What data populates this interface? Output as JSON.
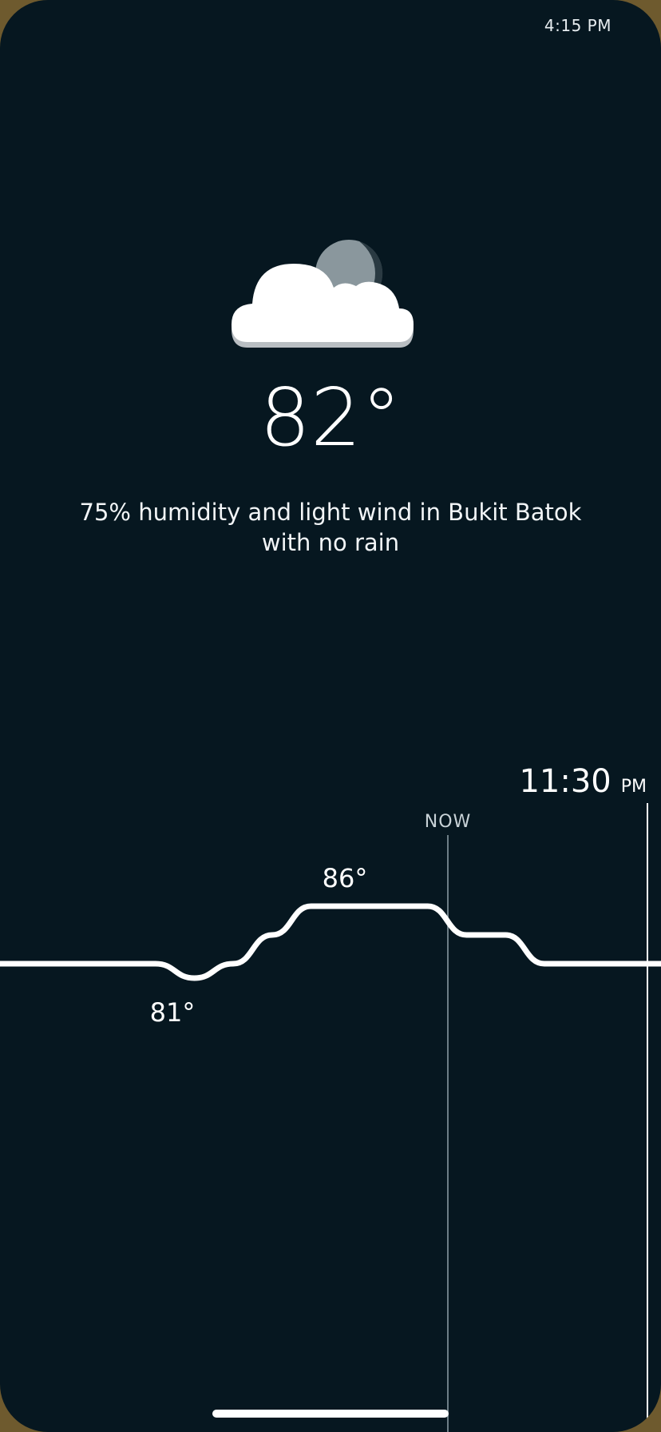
{
  "status_bar": {
    "time": "4:15 PM"
  },
  "current": {
    "icon": "partly-cloudy-night-icon",
    "temperature": "82°",
    "summary": "75% humidity and light wind in Bukit Batok with no rain"
  },
  "timeline": {
    "now_label": "NOW",
    "end_time": "11:30",
    "end_period": "PM",
    "high_label": "86°",
    "low_label": "81°"
  },
  "chart_data": {
    "type": "line",
    "series": [
      {
        "values": [
          82,
          82,
          82,
          82,
          82,
          81,
          82,
          84,
          86,
          86,
          86,
          86,
          84,
          84,
          82,
          82,
          82,
          82
        ]
      }
    ],
    "high": 86,
    "low": 81
  },
  "colors": {
    "background": "#061720",
    "foreground": "#ffffff",
    "moon": "#8a979d"
  }
}
